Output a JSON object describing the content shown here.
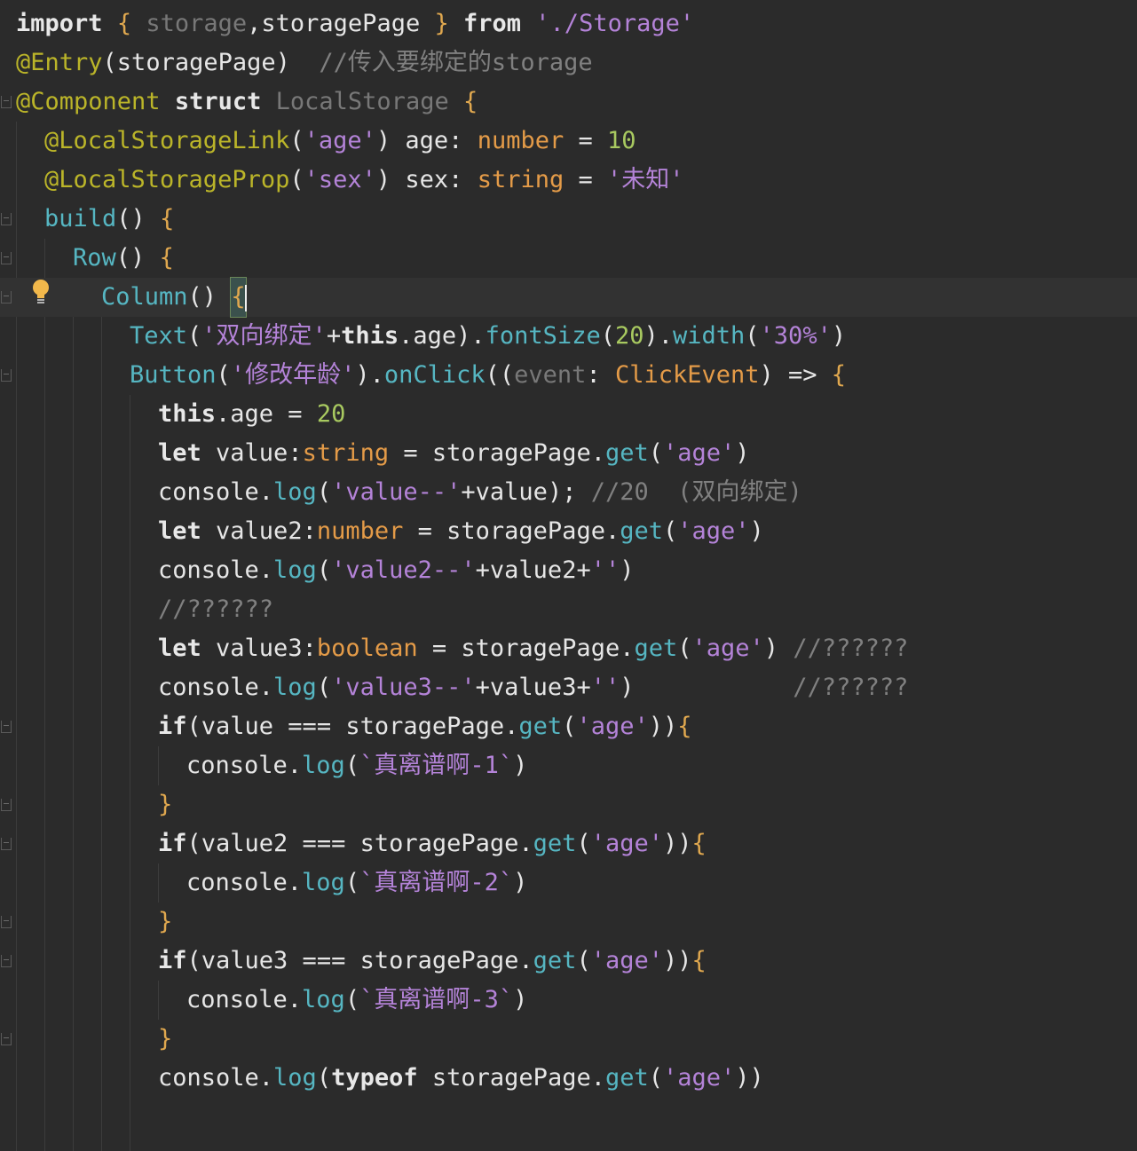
{
  "editor": {
    "lines": [
      {
        "indent": 0,
        "tokens": [
          {
            "c": "kw2",
            "t": "import"
          },
          {
            "c": "plain",
            "t": " "
          },
          {
            "c": "brace",
            "t": "{"
          },
          {
            "c": "plain",
            "t": " "
          },
          {
            "c": "dim",
            "t": "storage"
          },
          {
            "c": "plain",
            "t": ",storagePage "
          },
          {
            "c": "brace",
            "t": "}"
          },
          {
            "c": "plain",
            "t": " "
          },
          {
            "c": "kw2",
            "t": "from"
          },
          {
            "c": "plain",
            "t": " "
          },
          {
            "c": "str",
            "t": "'./Storage'"
          }
        ]
      },
      {
        "indent": 0,
        "tokens": [
          {
            "c": "anno",
            "t": "@Entry"
          },
          {
            "c": "plain",
            "t": "(storagePage)  "
          },
          {
            "c": "cmt",
            "t": "//传入要绑定的storage"
          }
        ]
      },
      {
        "indent": 0,
        "tokens": [
          {
            "c": "anno",
            "t": "@Component"
          },
          {
            "c": "plain",
            "t": " "
          },
          {
            "c": "kw2",
            "t": "struct"
          },
          {
            "c": "plain",
            "t": " "
          },
          {
            "c": "dim",
            "t": "LocalStorage"
          },
          {
            "c": "plain",
            "t": " "
          },
          {
            "c": "brace",
            "t": "{"
          }
        ]
      },
      {
        "indent": 1,
        "tokens": [
          {
            "c": "anno",
            "t": "@LocalStorageLink"
          },
          {
            "c": "plain",
            "t": "("
          },
          {
            "c": "str",
            "t": "'age'"
          },
          {
            "c": "plain",
            "t": ") age: "
          },
          {
            "c": "type",
            "t": "number"
          },
          {
            "c": "plain",
            "t": " = "
          },
          {
            "c": "num",
            "t": "10"
          }
        ]
      },
      {
        "indent": 1,
        "tokens": [
          {
            "c": "anno",
            "t": "@LocalStorageProp"
          },
          {
            "c": "plain",
            "t": "("
          },
          {
            "c": "str",
            "t": "'sex'"
          },
          {
            "c": "plain",
            "t": ") sex: "
          },
          {
            "c": "type",
            "t": "string"
          },
          {
            "c": "plain",
            "t": " = "
          },
          {
            "c": "str",
            "t": "'未知'"
          }
        ]
      },
      {
        "indent": 1,
        "tokens": [
          {
            "c": "fn",
            "t": "build"
          },
          {
            "c": "plain",
            "t": "() "
          },
          {
            "c": "brace",
            "t": "{"
          }
        ]
      },
      {
        "indent": 2,
        "tokens": [
          {
            "c": "fn",
            "t": "Row"
          },
          {
            "c": "plain",
            "t": "() "
          },
          {
            "c": "brace",
            "t": "{"
          }
        ]
      },
      {
        "indent": 3,
        "current": true,
        "tokens": [
          {
            "c": "fn",
            "t": "Column"
          },
          {
            "c": "plain",
            "t": "() "
          },
          {
            "c": "brace caret-box",
            "t": "{"
          }
        ]
      },
      {
        "indent": 4,
        "tokens": [
          {
            "c": "fn",
            "t": "Text"
          },
          {
            "c": "plain",
            "t": "("
          },
          {
            "c": "str",
            "t": "'双向绑定'"
          },
          {
            "c": "plain",
            "t": "+"
          },
          {
            "c": "kw2",
            "t": "this"
          },
          {
            "c": "plain",
            "t": ".age)."
          },
          {
            "c": "fn",
            "t": "fontSize"
          },
          {
            "c": "plain",
            "t": "("
          },
          {
            "c": "num",
            "t": "20"
          },
          {
            "c": "plain",
            "t": ")."
          },
          {
            "c": "fn",
            "t": "width"
          },
          {
            "c": "plain",
            "t": "("
          },
          {
            "c": "str",
            "t": "'30%'"
          },
          {
            "c": "plain",
            "t": ")"
          }
        ]
      },
      {
        "indent": 4,
        "tokens": [
          {
            "c": "fn",
            "t": "Button"
          },
          {
            "c": "plain",
            "t": "("
          },
          {
            "c": "str",
            "t": "'修改年龄'"
          },
          {
            "c": "plain",
            "t": ")."
          },
          {
            "c": "fn",
            "t": "onClick"
          },
          {
            "c": "plain",
            "t": "(("
          },
          {
            "c": "dim",
            "t": "event"
          },
          {
            "c": "plain",
            "t": ": "
          },
          {
            "c": "type",
            "t": "ClickEvent"
          },
          {
            "c": "plain",
            "t": ") => "
          },
          {
            "c": "brace",
            "t": "{"
          }
        ]
      },
      {
        "indent": 5,
        "tokens": [
          {
            "c": "kw2",
            "t": "this"
          },
          {
            "c": "plain",
            "t": ".age = "
          },
          {
            "c": "num",
            "t": "20"
          }
        ]
      },
      {
        "indent": 5,
        "tokens": [
          {
            "c": "kw2",
            "t": "let"
          },
          {
            "c": "plain",
            "t": " value:"
          },
          {
            "c": "type",
            "t": "string"
          },
          {
            "c": "plain",
            "t": " = storagePage."
          },
          {
            "c": "fn",
            "t": "get"
          },
          {
            "c": "plain",
            "t": "("
          },
          {
            "c": "str",
            "t": "'age'"
          },
          {
            "c": "plain",
            "t": ")"
          }
        ]
      },
      {
        "indent": 5,
        "tokens": [
          {
            "c": "plain",
            "t": "console."
          },
          {
            "c": "fn",
            "t": "log"
          },
          {
            "c": "plain",
            "t": "("
          },
          {
            "c": "str",
            "t": "'value--'"
          },
          {
            "c": "plain",
            "t": "+value); "
          },
          {
            "c": "cmt",
            "t": "//20  (双向绑定)"
          }
        ]
      },
      {
        "indent": 5,
        "tokens": [
          {
            "c": "kw2",
            "t": "let"
          },
          {
            "c": "plain",
            "t": " value2:"
          },
          {
            "c": "type",
            "t": "number"
          },
          {
            "c": "plain",
            "t": " = storagePage."
          },
          {
            "c": "fn",
            "t": "get"
          },
          {
            "c": "plain",
            "t": "("
          },
          {
            "c": "str",
            "t": "'age'"
          },
          {
            "c": "plain",
            "t": ")"
          }
        ]
      },
      {
        "indent": 5,
        "tokens": [
          {
            "c": "plain",
            "t": "console."
          },
          {
            "c": "fn",
            "t": "log"
          },
          {
            "c": "plain",
            "t": "("
          },
          {
            "c": "str",
            "t": "'value2--'"
          },
          {
            "c": "plain",
            "t": "+value2+"
          },
          {
            "c": "str",
            "t": "''"
          },
          {
            "c": "plain",
            "t": ")"
          }
        ]
      },
      {
        "indent": 5,
        "tokens": [
          {
            "c": "cmt",
            "t": "//??????"
          }
        ]
      },
      {
        "indent": 5,
        "tokens": [
          {
            "c": "kw2",
            "t": "let"
          },
          {
            "c": "plain",
            "t": " value3:"
          },
          {
            "c": "type",
            "t": "boolean"
          },
          {
            "c": "plain",
            "t": " = storagePage."
          },
          {
            "c": "fn",
            "t": "get"
          },
          {
            "c": "plain",
            "t": "("
          },
          {
            "c": "str",
            "t": "'age'"
          },
          {
            "c": "plain",
            "t": ") "
          },
          {
            "c": "cmt",
            "t": "//??????"
          }
        ]
      },
      {
        "indent": 5,
        "tokens": [
          {
            "c": "plain",
            "t": "console."
          },
          {
            "c": "fn",
            "t": "log"
          },
          {
            "c": "plain",
            "t": "("
          },
          {
            "c": "str",
            "t": "'value3--'"
          },
          {
            "c": "plain",
            "t": "+value3+"
          },
          {
            "c": "str",
            "t": "''"
          },
          {
            "c": "plain",
            "t": ")           "
          },
          {
            "c": "cmt",
            "t": "//??????"
          }
        ]
      },
      {
        "indent": 5,
        "tokens": [
          {
            "c": "kw2",
            "t": "if"
          },
          {
            "c": "plain",
            "t": "(value === storagePage."
          },
          {
            "c": "fn",
            "t": "get"
          },
          {
            "c": "plain",
            "t": "("
          },
          {
            "c": "str",
            "t": "'age'"
          },
          {
            "c": "plain",
            "t": "))"
          },
          {
            "c": "brace",
            "t": "{"
          }
        ]
      },
      {
        "indent": 6,
        "tokens": [
          {
            "c": "plain",
            "t": "console."
          },
          {
            "c": "fn",
            "t": "log"
          },
          {
            "c": "plain",
            "t": "("
          },
          {
            "c": "str",
            "t": "`真离谱啊-1`"
          },
          {
            "c": "plain",
            "t": ")"
          }
        ]
      },
      {
        "indent": 5,
        "tokens": [
          {
            "c": "brace",
            "t": "}"
          }
        ]
      },
      {
        "indent": 5,
        "tokens": [
          {
            "c": "kw2",
            "t": "if"
          },
          {
            "c": "plain",
            "t": "(value2 === storagePage."
          },
          {
            "c": "fn",
            "t": "get"
          },
          {
            "c": "plain",
            "t": "("
          },
          {
            "c": "str",
            "t": "'age'"
          },
          {
            "c": "plain",
            "t": "))"
          },
          {
            "c": "brace",
            "t": "{"
          }
        ]
      },
      {
        "indent": 6,
        "tokens": [
          {
            "c": "plain",
            "t": "console."
          },
          {
            "c": "fn",
            "t": "log"
          },
          {
            "c": "plain",
            "t": "("
          },
          {
            "c": "str",
            "t": "`真离谱啊-2`"
          },
          {
            "c": "plain",
            "t": ")"
          }
        ]
      },
      {
        "indent": 5,
        "tokens": [
          {
            "c": "brace",
            "t": "}"
          }
        ]
      },
      {
        "indent": 5,
        "tokens": [
          {
            "c": "kw2",
            "t": "if"
          },
          {
            "c": "plain",
            "t": "(value3 === storagePage."
          },
          {
            "c": "fn",
            "t": "get"
          },
          {
            "c": "plain",
            "t": "("
          },
          {
            "c": "str",
            "t": "'age'"
          },
          {
            "c": "plain",
            "t": "))"
          },
          {
            "c": "brace",
            "t": "{"
          }
        ]
      },
      {
        "indent": 6,
        "tokens": [
          {
            "c": "plain",
            "t": "console."
          },
          {
            "c": "fn",
            "t": "log"
          },
          {
            "c": "plain",
            "t": "("
          },
          {
            "c": "str",
            "t": "`真离谱啊-3`"
          },
          {
            "c": "plain",
            "t": ")"
          }
        ]
      },
      {
        "indent": 5,
        "tokens": [
          {
            "c": "brace",
            "t": "}"
          }
        ]
      },
      {
        "indent": 5,
        "tokens": [
          {
            "c": "plain",
            "t": "console."
          },
          {
            "c": "fn",
            "t": "log"
          },
          {
            "c": "plain",
            "t": "("
          },
          {
            "c": "kw2",
            "t": "typeof"
          },
          {
            "c": "plain",
            "t": " storagePage."
          },
          {
            "c": "fn",
            "t": "get"
          },
          {
            "c": "plain",
            "t": "("
          },
          {
            "c": "str",
            "t": "'age'"
          },
          {
            "c": "plain",
            "t": "))"
          }
        ]
      }
    ]
  },
  "colors": {
    "background": "#2b2b2b",
    "current_line": "#323232",
    "string": "#b483d8",
    "number": "#a8c960",
    "type": "#e49b48",
    "function": "#56b6c2",
    "annotation": "#bbb529",
    "comment": "#808080",
    "lightbulb": "#f2b84b"
  },
  "icons": [
    "lightbulb-icon",
    "fold-marker-icon"
  ]
}
